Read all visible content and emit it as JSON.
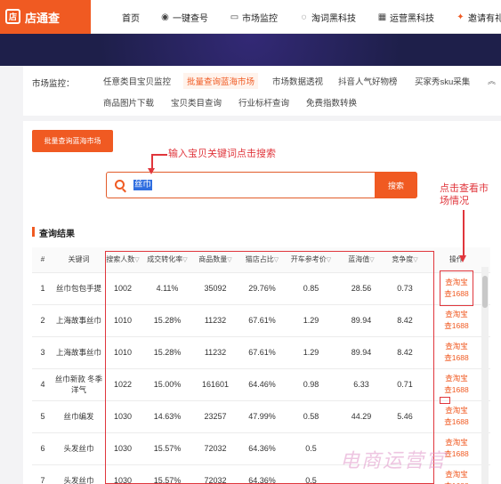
{
  "brand": {
    "name": "店通查",
    "logo_mark": "店"
  },
  "topnav": {
    "items": [
      {
        "label": "首页",
        "icon": ""
      },
      {
        "label": "一键查号",
        "icon": "eye-icon"
      },
      {
        "label": "市场监控",
        "icon": "monitor-icon"
      },
      {
        "label": "淘词黑科技",
        "icon": "chat-icon"
      },
      {
        "label": "运营黑科技",
        "icon": "grid-icon"
      },
      {
        "label": "邀请有礼",
        "icon": "gift-icon"
      }
    ]
  },
  "subnav": {
    "label": "市场监控：",
    "items": [
      "任意类目宝贝监控",
      "批量查询蓝海市场",
      "市场数据透视",
      "抖音人气好物榜",
      "买家秀sku采集",
      "商品图片下载",
      "宝贝类目查询",
      "行业标杆查询",
      "免费指数转换"
    ],
    "active_index": 1,
    "collapse_icon": "chevron-up-icon"
  },
  "batch_button": "批量查询蓝海市场",
  "search": {
    "value": "丝巾",
    "button": "搜索"
  },
  "section_title": "查询结果",
  "table": {
    "headers": [
      "#",
      "关键词",
      "搜索人数",
      "成交转化率",
      "商品数量",
      "猫店占比",
      "开车参考价",
      "蓝海值",
      "竞争度",
      "操作"
    ],
    "rows": [
      {
        "no": "1",
        "kw": "丝巾包包手提",
        "search": "1002",
        "conv": "4.11%",
        "items": "35092",
        "tmall": "29.76%",
        "cpc": "0.85",
        "blue": "28.56",
        "comp": "0.73"
      },
      {
        "no": "2",
        "kw": "上海故事丝巾",
        "search": "1010",
        "conv": "15.28%",
        "items": "11232",
        "tmall": "67.61%",
        "cpc": "1.29",
        "blue": "89.94",
        "comp": "8.42"
      },
      {
        "no": "3",
        "kw": "上海故事丝巾",
        "search": "1010",
        "conv": "15.28%",
        "items": "11232",
        "tmall": "67.61%",
        "cpc": "1.29",
        "blue": "89.94",
        "comp": "8.42"
      },
      {
        "no": "4",
        "kw": "丝巾新款 冬季洋气",
        "search": "1022",
        "conv": "15.00%",
        "items": "161601",
        "tmall": "64.46%",
        "cpc": "0.98",
        "blue": "6.33",
        "comp": "0.71"
      },
      {
        "no": "5",
        "kw": "丝巾编发",
        "search": "1030",
        "conv": "14.63%",
        "items": "23257",
        "tmall": "47.99%",
        "cpc": "0.58",
        "blue": "44.29",
        "comp": "5.46"
      },
      {
        "no": "6",
        "kw": "头发丝巾",
        "search": "1030",
        "conv": "15.57%",
        "items": "72032",
        "tmall": "64.36%",
        "cpc": "0.5",
        "blue": "",
        "comp": ""
      },
      {
        "no": "7",
        "kw": "头发丝巾",
        "search": "1030",
        "conv": "15.57%",
        "items": "72032",
        "tmall": "64.36%",
        "cpc": "0.5",
        "blue": "",
        "comp": ""
      }
    ],
    "op_taobao": "查淘宝",
    "op_1688": "查1688"
  },
  "annotations": {
    "search_hint": "输入宝贝关键词点击搜索",
    "market_hint_line1": "点击查看市",
    "market_hint_line2": "场情况"
  },
  "watermark": "电商运营官",
  "colors": {
    "accent": "#f05a22",
    "annotation": "#e0363c",
    "banner": "#1e1f4a"
  }
}
